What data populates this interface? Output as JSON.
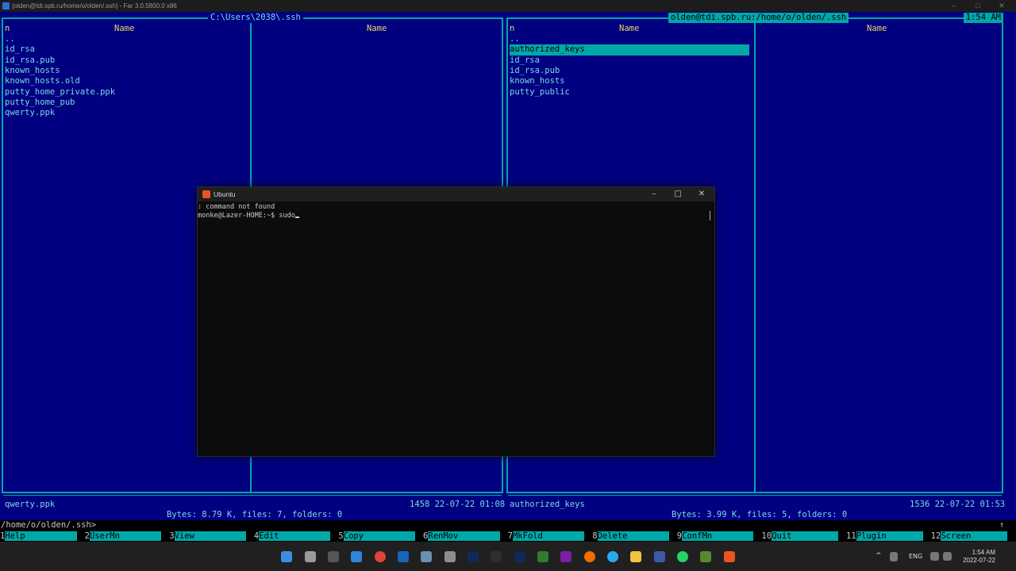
{
  "window": {
    "title": "{olden@tdi.spb.ru/home/o/olden/.ssh} - Far 3.0.5800.0 x86",
    "min": "–",
    "max": "□",
    "close": "✕"
  },
  "left_panel": {
    "path": "C:\\Users\\2038\\.ssh",
    "col_n": "n",
    "col_name_1": "Name",
    "col_name_2": "Name",
    "files": [
      "..",
      "id_rsa",
      "id_rsa.pub",
      "known_hosts",
      "known_hosts.old",
      "putty_home_private.ppk",
      "putty_home_pub",
      "qwerty.ppk"
    ],
    "current_file": "qwerty.ppk",
    "current_info": "1458 22-07-22 01:08",
    "summary": "Bytes: 8.79 K, files: 7, folders: 0"
  },
  "right_panel": {
    "path": "olden@tdi.spb.ru:/home/o/olden/.ssh",
    "clock": "1:54 AM",
    "col_n": "n",
    "col_name_1": "Name",
    "col_name_2": "Name",
    "files": [
      "..",
      "authorized_keys",
      "id_rsa",
      "id_rsa.pub",
      "known_hosts",
      "putty_public"
    ],
    "selected_index": 1,
    "current_file": "authorized_keys",
    "current_info": "1536 22-07-22 01:53",
    "summary": "Bytes: 3.99 K, files: 5, folders: 0"
  },
  "command_line": {
    "prompt": "/home/o/olden/.ssh>",
    "scroll_glyph": "↑"
  },
  "keybar": [
    {
      "num": "1",
      "label": "Help"
    },
    {
      "num": "2",
      "label": "UserMn"
    },
    {
      "num": "3",
      "label": "View"
    },
    {
      "num": "4",
      "label": "Edit"
    },
    {
      "num": "5",
      "label": "Copy"
    },
    {
      "num": "6",
      "label": "RenMov"
    },
    {
      "num": "7",
      "label": "MkFold"
    },
    {
      "num": "8",
      "label": "Delete"
    },
    {
      "num": "9",
      "label": "ConfMn"
    },
    {
      "num": "10",
      "label": "Quit"
    },
    {
      "num": "11",
      "label": "Plugin"
    },
    {
      "num": "12",
      "label": "Screen"
    }
  ],
  "ubuntu": {
    "title": "Ubuntu",
    "line1": ": command not found",
    "prompt": "monke@Lazer-HOME:~$ ",
    "typed": "sudo",
    "btn_min": "–",
    "btn_max": "□",
    "btn_close": "✕"
  },
  "tray": {
    "chevron": "^",
    "lang": "ENG",
    "time": "1:54 AM",
    "date": "2022-07-22"
  },
  "colors": {
    "far_bg": "#000080",
    "cyan": "#00a8a8",
    "file_text": "#7ed7e6",
    "header": "#e8d36a"
  }
}
